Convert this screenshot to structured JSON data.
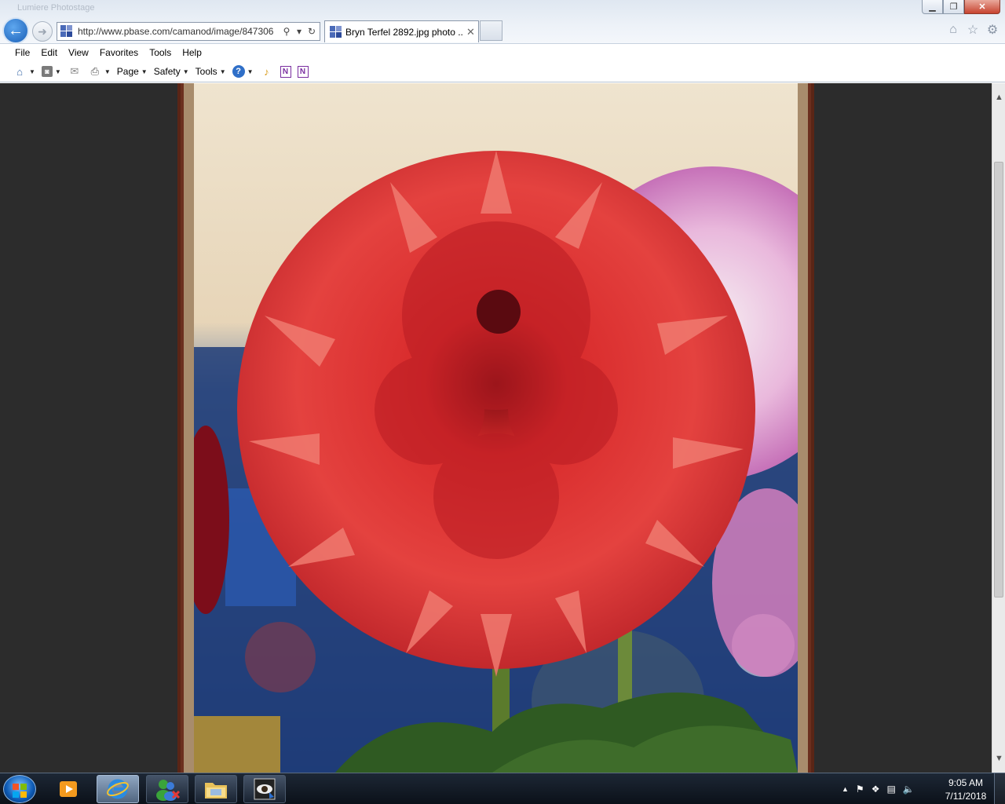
{
  "window": {
    "ghost_title": "Lumiere Photostage",
    "controls": {
      "minimize": "▁",
      "restore": "❐",
      "close": "✕"
    }
  },
  "nav": {
    "back_glyph": "←",
    "forward_glyph": "➜",
    "address": "http://www.pbase.com/camanod/image/847306",
    "search_glyph": "⚲",
    "dropdown_glyph": "▾",
    "refresh_glyph": "↻"
  },
  "tabs": [
    {
      "title": "Bryn Terfel 2892.jpg photo ...",
      "close_glyph": "✕"
    }
  ],
  "right_icons": {
    "home": "⌂",
    "favorites": "☆",
    "settings": "⚙"
  },
  "menu": [
    "File",
    "Edit",
    "View",
    "Favorites",
    "Tools",
    "Help"
  ],
  "command_bar": {
    "home": "⌂",
    "feeds": "◙",
    "mail": "✉",
    "print": "⎙",
    "page": "Page",
    "safety": "Safety",
    "tools": "Tools",
    "help": "?",
    "research": "♪",
    "onenote1": "N",
    "onenote2": "N",
    "dropdown": "▼"
  },
  "content": {
    "image_subject": "red dahlia flower",
    "background_color": "#2c2c2c",
    "frame_color": "#6b2f1e"
  },
  "scrollbar": {
    "up": "▲",
    "down": "▼",
    "thumb_position_pct": 11
  },
  "taskbar": {
    "items": [
      "media-player",
      "internet-explorer",
      "windows-live-messenger",
      "file-explorer",
      "photo-viewer"
    ],
    "active_item": "internet-explorer"
  },
  "tray": {
    "show_hidden": "▲",
    "flag": "⚑",
    "dropbox": "❖",
    "network": "▤",
    "volume": "🔈"
  },
  "clock": {
    "time": "9:05 AM",
    "date": "7/11/2018"
  }
}
